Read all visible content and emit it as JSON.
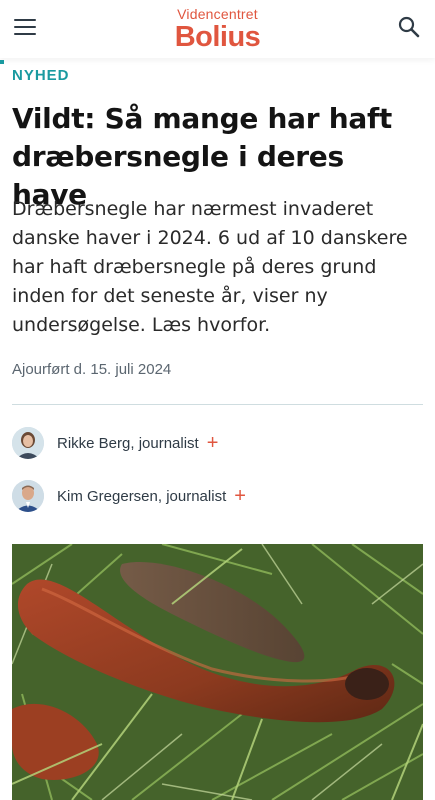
{
  "header": {
    "logo_top": "Videncentret",
    "logo_bottom": "Bolius",
    "menu_icon": "hamburger-menu-icon",
    "search_icon": "search-icon",
    "accent_color": "#e0563f"
  },
  "article": {
    "category": "NYHED",
    "category_color": "#1a9aa0",
    "headline": "Vildt: Så mange har haft dræbersnegle i deres have",
    "lead": "Dræbersnegle har nærmest invaderet danske haver i 2024. 6 ud af 10 danskere har haft dræbersnegle på deres grund inden for det seneste år, viser ny undersøgelse. Læs hvorfor.",
    "updated": "Ajourført d. 15. juli 2024"
  },
  "authors": [
    {
      "name": "Rikke Berg, journalist",
      "plus": "+"
    },
    {
      "name": "Kim Gregersen, journalist",
      "plus": "+"
    }
  ],
  "hero_image": {
    "subject": "slug-in-grass-photo"
  }
}
